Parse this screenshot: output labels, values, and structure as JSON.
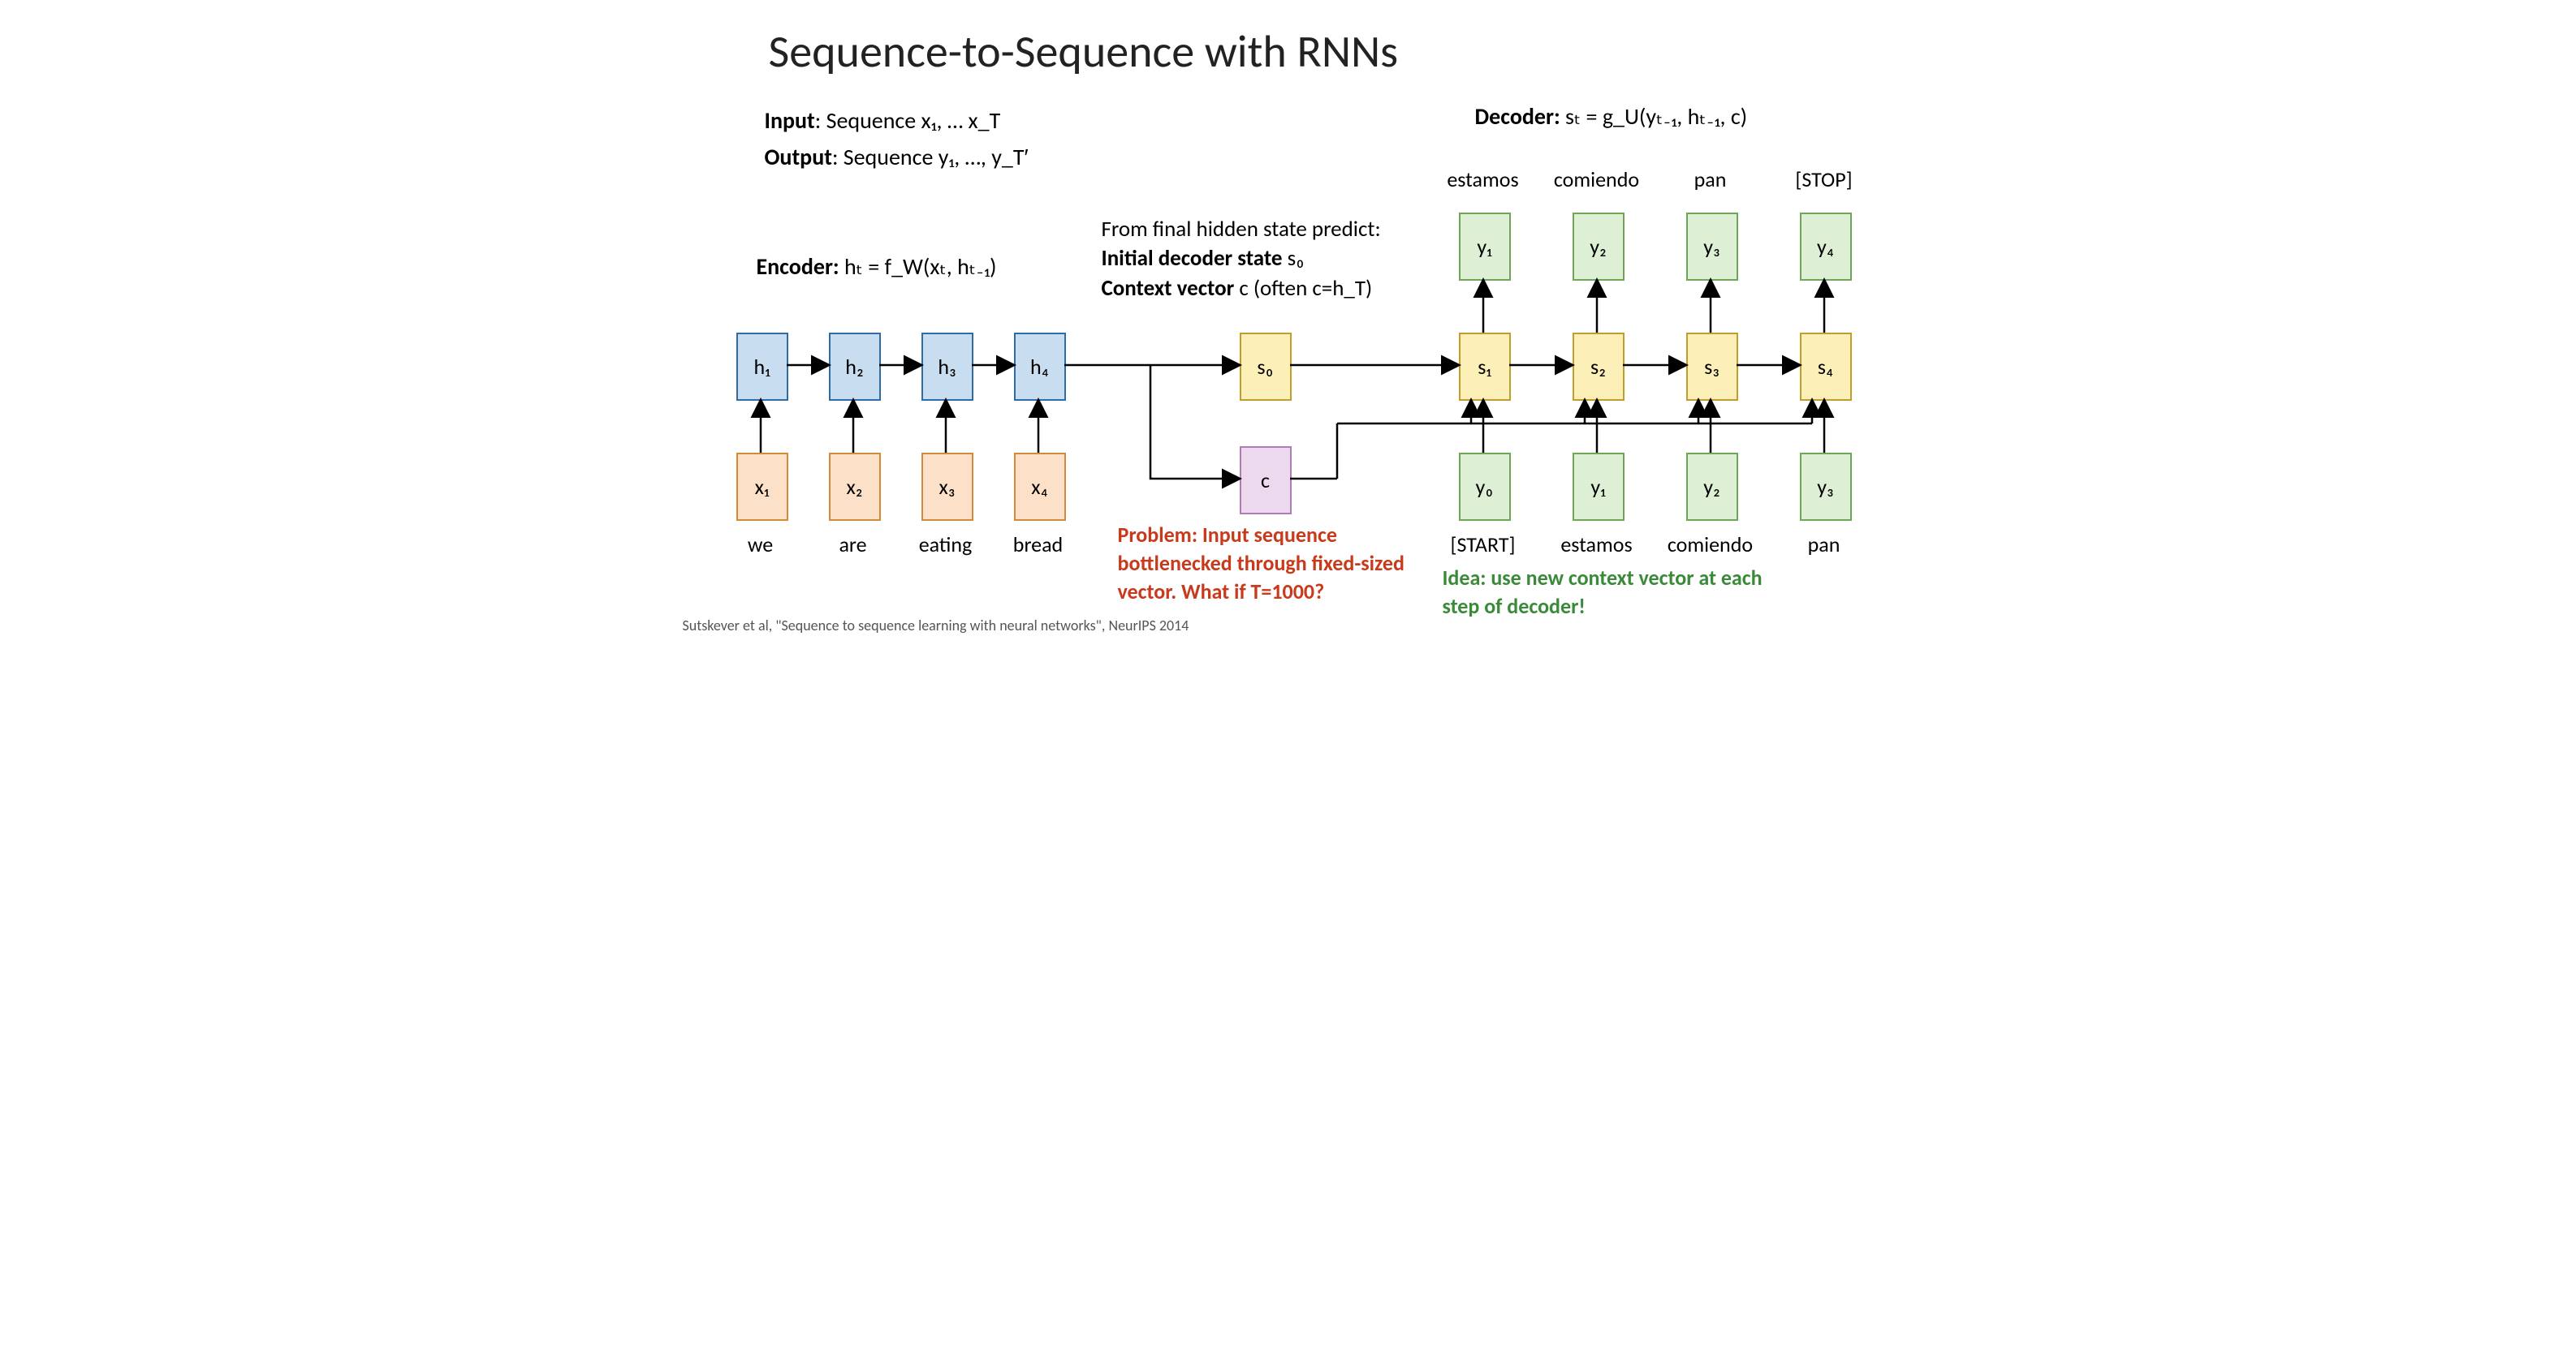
{
  "title": "Sequence-to-Sequence with RNNs",
  "input_label": "Input",
  "input_text": ": Sequence x₁, … x_T",
  "output_label": "Output",
  "output_text": ": Sequence y₁, …, y_T′",
  "encoder_label": "Encoder:",
  "encoder_eq": " hₜ = f_W(xₜ, hₜ₋₁)",
  "decoder_label": "Decoder:",
  "decoder_eq": " sₜ = g_U(yₜ₋₁, hₜ₋₁, c)",
  "predict_line1": "From final hidden state predict:",
  "predict_line2a": "Initial decoder state",
  "predict_line2b": " s₀",
  "predict_line3a": "Context vector",
  "predict_line3b": " c (often c=h_T)",
  "encoder_h": [
    "h₁",
    "h₂",
    "h₃",
    "h₄"
  ],
  "encoder_x": [
    "x₁",
    "x₂",
    "x₃",
    "x₄"
  ],
  "encoder_words": [
    "we",
    "are",
    "eating",
    "bread"
  ],
  "s0": "s₀",
  "c": "c",
  "decoder_s": [
    "s₁",
    "s₂",
    "s₃",
    "s₄"
  ],
  "decoder_y_out": [
    "y₁",
    "y₂",
    "y₃",
    "y₄"
  ],
  "decoder_y_in": [
    "y₀",
    "y₁",
    "y₂",
    "y₃"
  ],
  "decoder_out_words": [
    "estamos",
    "comiendo",
    "pan",
    "[STOP]"
  ],
  "decoder_in_words": [
    "[START]",
    "estamos",
    "comiendo",
    "pan"
  ],
  "problem": "Problem: Input sequence bottlenecked through fixed-sized vector. What if T=1000?",
  "idea": "Idea: use new context vector at each step of decoder!",
  "citation": "Sutskever et al, \"Sequence to sequence learning with neural networks\", NeurIPS 2014"
}
